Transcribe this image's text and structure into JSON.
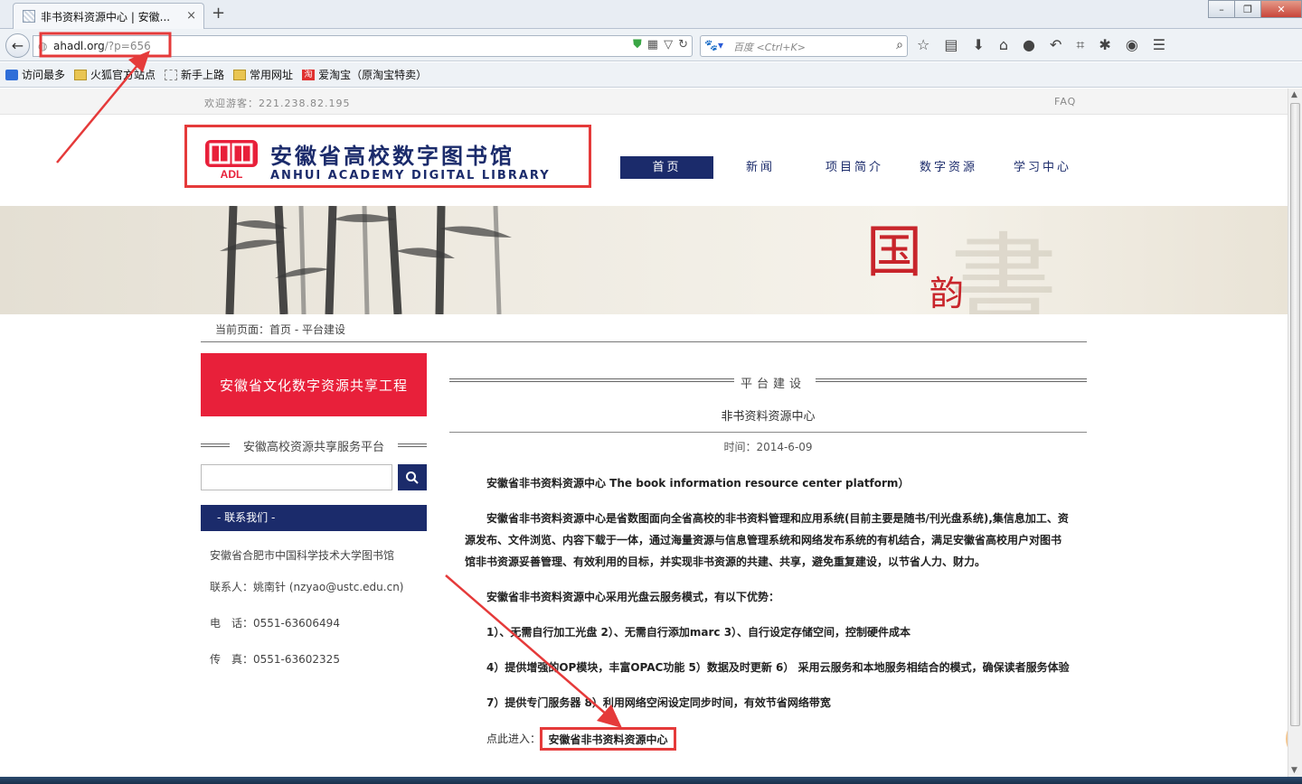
{
  "browser": {
    "tab_title": "非书资料资源中心 | 安徽...",
    "tab_close": "×",
    "new_tab": "+",
    "url_domain": "ahadl.org",
    "url_path": "/?p=656",
    "search_placeholder": "百度 <Ctrl+K>",
    "bookmarks": [
      {
        "label": "访问最多",
        "icon": "blue"
      },
      {
        "label": "火狐官方站点",
        "icon": "folder"
      },
      {
        "label": "新手上路",
        "icon": "dash"
      },
      {
        "label": "常用网址",
        "icon": "folder"
      },
      {
        "label": "爱淘宝（原淘宝特卖）",
        "icon": "red"
      }
    ]
  },
  "site": {
    "welcome": "欢迎游客：221.238.82.195",
    "faq": "FAQ",
    "logo_cn": "安徽省高校数字图书馆",
    "logo_en": "ANHUI ACADEMY DIGITAL LIBRARY",
    "logo_mark": "ADL",
    "nav": [
      "首页",
      "新闻",
      "项目简介",
      "数字资源",
      "学习中心"
    ],
    "banner_char1": "国",
    "banner_char2": "韵",
    "breadcrumb": "当前页面：首页 - 平台建设"
  },
  "sidebar": {
    "feature_button": "安徽省文化数字资源共享工程",
    "platform_title": "安徽高校资源共享服务平台",
    "contact_header": "- 联系我们 -",
    "address": "安徽省合肥市中国科学技术大学图书馆",
    "contact_person": "联系人：姚南针 (nzyao@ustc.edu.cn)",
    "phone": "电　话：0551-63606494",
    "fax": "传　真：0551-63602325"
  },
  "article": {
    "section": "平台建设",
    "title": "非书资料资源中心",
    "date": "时间：2014-6-09",
    "p1": "安徽省非书资料资源中心 The book information resource center platform）",
    "p2": "安徽省非书资料资源中心是省数图面向全省高校的非书资料管理和应用系统(目前主要是随书/刊光盘系统),集信息加工、资源发布、文件浏览、内容下载于一体，通过海量资源与信息管理系统和网络发布系统的有机结合，满足安徽省高校用户对图书馆非书资源妥善管理、有效利用的目标，并实现非书资源的共建、共享，避免重复建设，以节省人力、财力。",
    "p3": "安徽省非书资料资源中心采用光盘云服务模式，有以下优势：",
    "p4": "1）、无需自行加工光盘 2）、无需自行添加marc 3）、自行设定存储空间，控制硬件成本",
    "p5": "4）提供增强的OP模块，丰富OPAC功能 5）数据及时更新 6） 采用云服务和本地服务相结合的模式，确保读者服务体验",
    "p6": "7）提供专门服务器 8）利用网络空闲设定同步时间，有效节省网络带宽",
    "entry_label": "点此进入：",
    "entry_link": "安徽省非书资料资源中心"
  },
  "float_badge": "70",
  "colors": {
    "navy": "#1b2b6b",
    "red": "#e8203a",
    "annotation": "#e53a3a"
  }
}
